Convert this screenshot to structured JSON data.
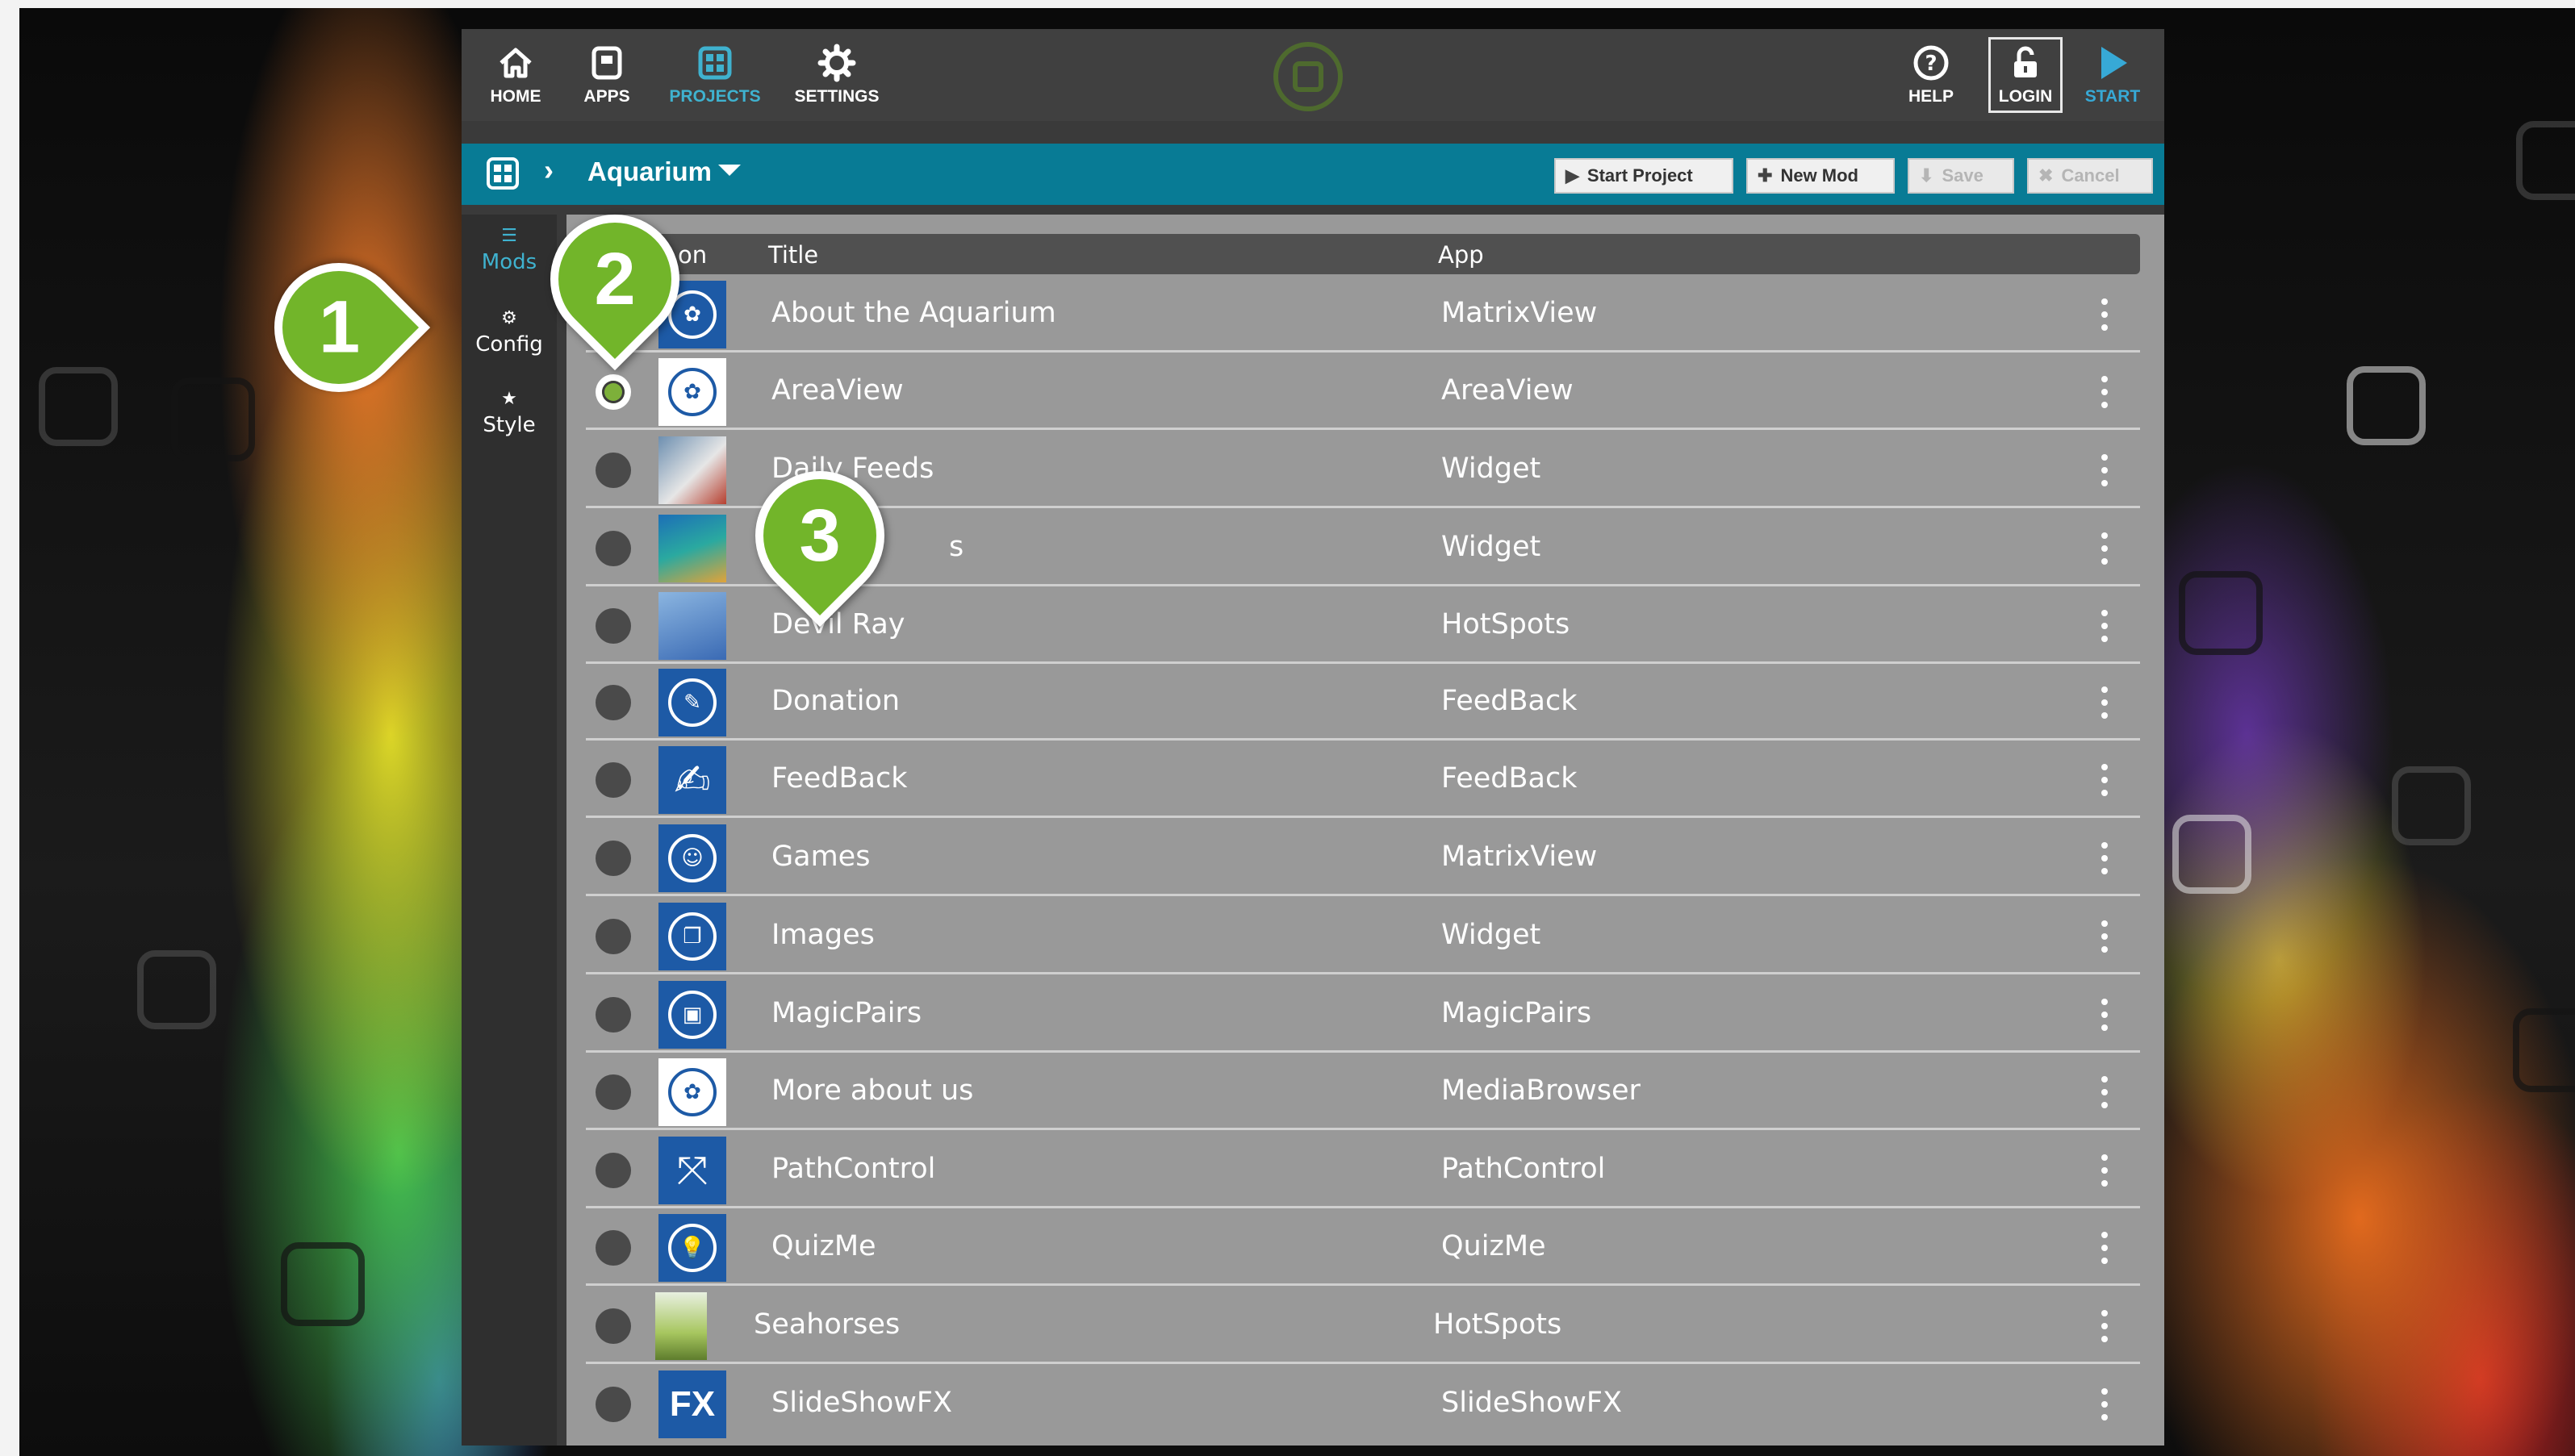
{
  "nav": {
    "home": "HOME",
    "apps": "APPS",
    "projects": "PROJECTS",
    "settings": "SETTINGS",
    "help": "HELP",
    "login": "LOGIN",
    "start": "START",
    "active": "PROJECTS"
  },
  "breadcrumb": {
    "project": "Aquarium"
  },
  "toolbar": {
    "start_project": "Start Project",
    "new_mod": "New Mod",
    "save": "Save",
    "cancel": "Cancel"
  },
  "sidebar": {
    "items": [
      {
        "label": "Mods",
        "icon": "list-icon",
        "active": true
      },
      {
        "label": "Config",
        "icon": "gear-icon",
        "active": false
      },
      {
        "label": "Style",
        "icon": "star-icon",
        "active": false
      }
    ]
  },
  "table": {
    "columns": [
      "on",
      "Title",
      "App"
    ],
    "rows": [
      {
        "title": "About the Aquarium",
        "app": "MatrixView",
        "selected": false
      },
      {
        "title": "AreaView",
        "app": "AreaView",
        "selected": true
      },
      {
        "title": "Daily Feeds",
        "app": "Widget",
        "selected": false
      },
      {
        "title": "s",
        "app": "Widget",
        "selected": false
      },
      {
        "title": "Devil Ray",
        "app": "HotSpots",
        "selected": false
      },
      {
        "title": "Donation",
        "app": "FeedBack",
        "selected": false
      },
      {
        "title": "FeedBack",
        "app": "FeedBack",
        "selected": false
      },
      {
        "title": "Games",
        "app": "MatrixView",
        "selected": false
      },
      {
        "title": "Images",
        "app": "Widget",
        "selected": false
      },
      {
        "title": "MagicPairs",
        "app": "MagicPairs",
        "selected": false
      },
      {
        "title": "More about us",
        "app": "MediaBrowser",
        "selected": false
      },
      {
        "title": "PathControl",
        "app": "PathControl",
        "selected": false
      },
      {
        "title": "QuizMe",
        "app": "QuizMe",
        "selected": false
      },
      {
        "title": "Seahorses",
        "app": "HotSpots",
        "selected": false
      },
      {
        "title": "SlideShowFX",
        "app": "SlideShowFX",
        "selected": false
      }
    ],
    "thumb_fx": "FX"
  },
  "markers": [
    "1",
    "2",
    "3"
  ],
  "colors": {
    "accent_teal": "#087b95",
    "active_blue": "#3fb2cf",
    "marker_green": "#72b52a"
  }
}
